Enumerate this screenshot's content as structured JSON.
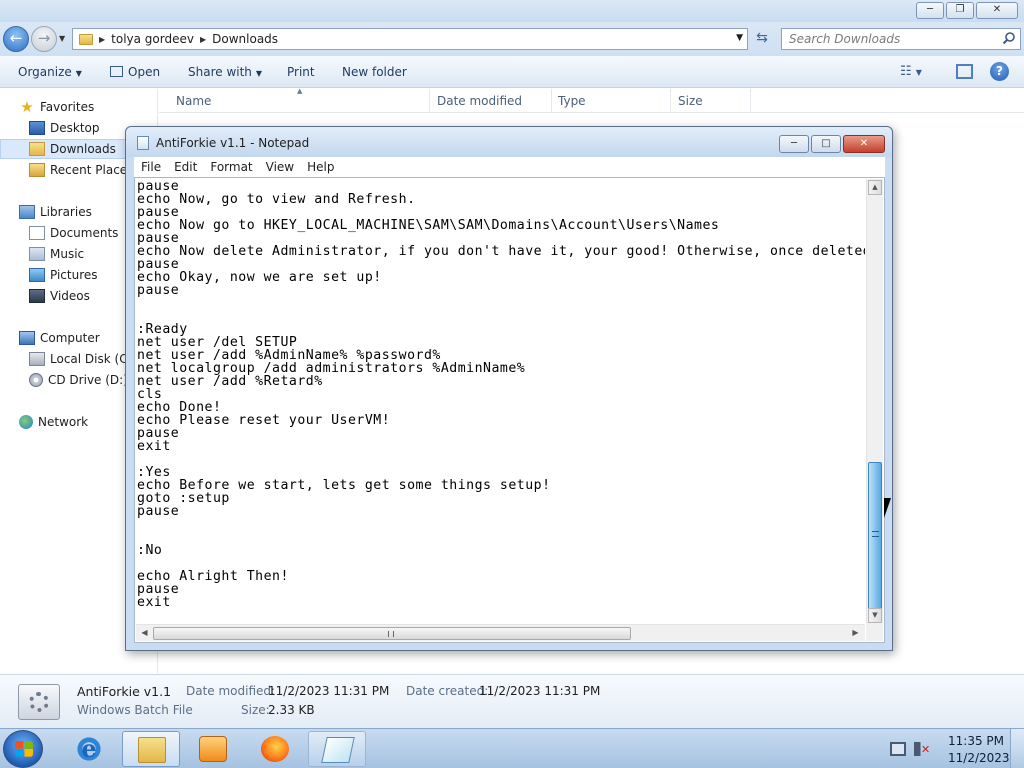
{
  "explorer": {
    "address": {
      "crumbs": [
        "tolya gordeev",
        "Downloads"
      ]
    },
    "search": {
      "placeholder": "Search Downloads"
    },
    "toolbar": {
      "organize": "Organize",
      "open": "Open",
      "share_with": "Share with",
      "print": "Print",
      "new_folder": "New folder"
    },
    "nav": {
      "favorites": "Favorites",
      "desktop": "Desktop",
      "downloads": "Downloads",
      "recent_places": "Recent Places",
      "libraries": "Libraries",
      "documents": "Documents",
      "music": "Music",
      "pictures": "Pictures",
      "videos": "Videos",
      "computer": "Computer",
      "local_disk": "Local Disk (C:)",
      "cd_drive": "CD Drive (D:) V",
      "network": "Network"
    },
    "columns": {
      "name": "Name",
      "date_modified": "Date modified",
      "type": "Type",
      "size": "Size"
    },
    "details": {
      "file_name": "AntiForkie v1.1",
      "file_type": "Windows Batch File",
      "date_modified_label": "Date modified:",
      "date_modified": "11/2/2023 11:31 PM",
      "date_created_label": "Date created:",
      "date_created": "11/2/2023 11:31 PM",
      "size_label": "Size:",
      "size": "2.33 KB"
    }
  },
  "notepad": {
    "title": "AntiForkie v1.1 - Notepad",
    "menu": [
      "File",
      "Edit",
      "Format",
      "View",
      "Help"
    ],
    "lines": [
      "pause",
      "echo Now, go to view and Refresh.",
      "pause",
      "echo Now go to HKEY_LOCAL_MACHINE\\SAM\\SAM\\Domains\\Account\\Users\\Names",
      "pause",
      "echo Now delete Administrator, if you don't have it, your good! Otherwise, once deleted, th",
      "pause",
      "echo Okay, now we are set up!",
      "pause",
      "",
      "",
      ":Ready",
      "net user /del SETUP",
      "net user /add %AdminName% %password%",
      "net localgroup /add administrators %AdminName%",
      "net user /add %Retard%",
      "cls",
      "echo Done!",
      "echo Please reset your UserVM!",
      "pause",
      "exit",
      "",
      ":Yes",
      "echo Before we start, lets get some things setup!",
      "goto :setup",
      "pause",
      "",
      "",
      ":No",
      "",
      "echo Alright Then!",
      "pause",
      "exit"
    ]
  },
  "taskbar": {
    "clock": {
      "time": "11:35 PM",
      "date": "11/2/2023"
    }
  }
}
